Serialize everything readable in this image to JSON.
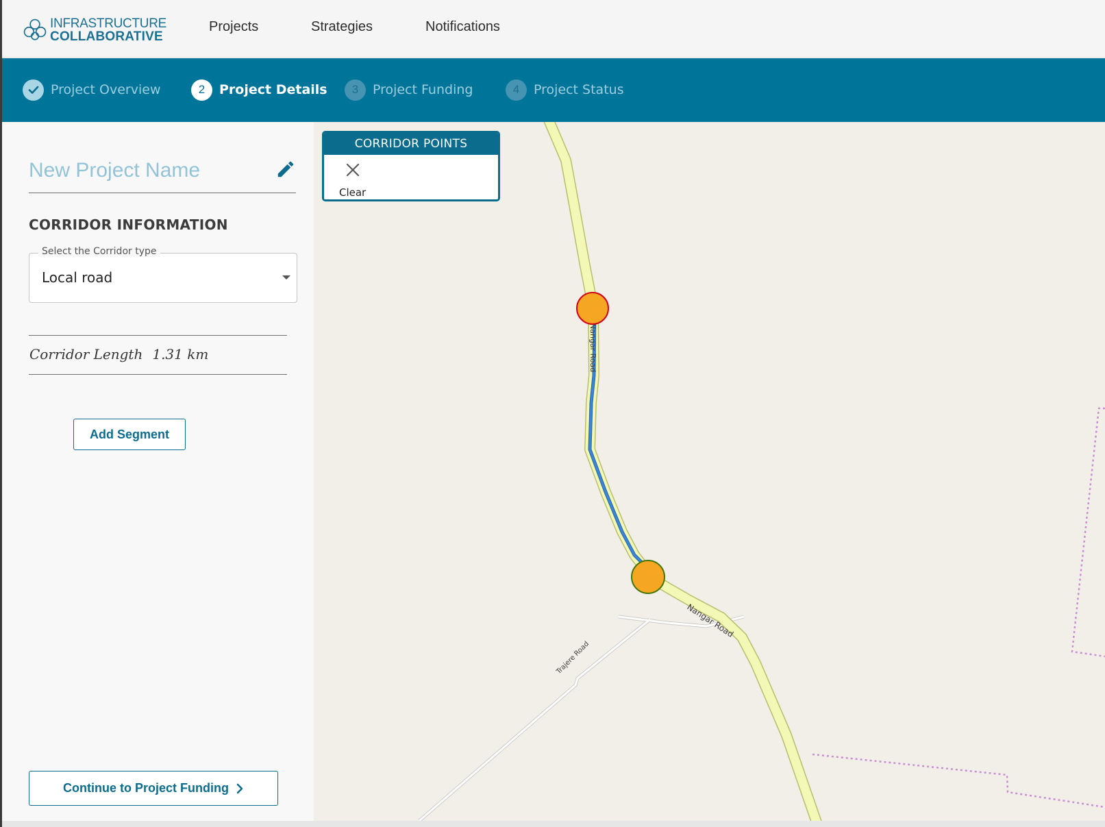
{
  "brand": {
    "line1": "INFRASTRUCTURE",
    "line2": "COLLABORATIVE",
    "color": "#1b6f93"
  },
  "nav": {
    "items": [
      {
        "label": "Projects"
      },
      {
        "label": "Strategies"
      },
      {
        "label": "Notifications"
      }
    ]
  },
  "stepper": {
    "background": "#007499",
    "steps": [
      {
        "number": "",
        "label": "Project Overview",
        "state": "done",
        "icon": "check-icon"
      },
      {
        "number": "2",
        "label": "Project Details",
        "state": "active"
      },
      {
        "number": "3",
        "label": "Project Funding",
        "state": "pending"
      },
      {
        "number": "4",
        "label": "Project Status",
        "state": "pending"
      }
    ]
  },
  "sidebar": {
    "project_name_placeholder": "New Project Name",
    "edit_icon": "pencil-icon",
    "section_title": "CORRIDOR INFORMATION",
    "corridor_type": {
      "legend": "Select the Corridor type",
      "value": "Local road"
    },
    "corridor_length": {
      "label": "Corridor Length",
      "value": "1.31 km"
    },
    "add_segment_label": "Add Segment",
    "continue_label": "Continue to Project Funding",
    "continue_icon": "chevron-right-icon"
  },
  "map": {
    "panel_title": "CORRIDOR POINTS",
    "clear_label": "Clear",
    "clear_icon": "close-icon",
    "road_labels": [
      "Nangar Road",
      "Nangar Road",
      "Trajere Road"
    ],
    "colors": {
      "background": "#f2efe9",
      "road_fill": "#f4f8b6",
      "road_casing": "#b7be6a",
      "route": "#3b86d8",
      "marker_fill": "#f5a623",
      "start_marker_ring": "#d0021b",
      "end_marker_ring": "#417505",
      "boundary": "#c88fd2"
    }
  }
}
